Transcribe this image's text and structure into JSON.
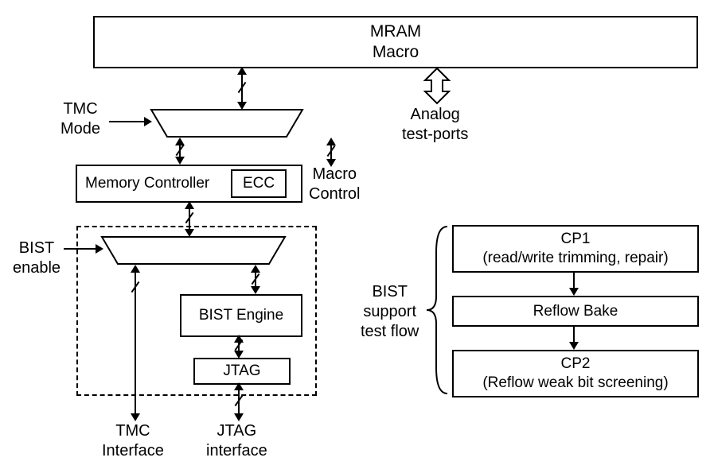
{
  "blocks": {
    "mram_macro_l1": "MRAM",
    "mram_macro_l2": "Macro",
    "mem_ctrl": "Memory Controller",
    "ecc": "ECC",
    "bist_engine": "BIST Engine",
    "jtag": "JTAG",
    "cp1_l1": "CP1",
    "cp1_l2": "(read/write trimming, repair)",
    "reflow_bake": "Reflow Bake",
    "cp2_l1": "CP2",
    "cp2_l2": "(Reflow weak bit screening)"
  },
  "labels": {
    "tmc_mode_l1": "TMC",
    "tmc_mode_l2": "Mode",
    "analog_l1": "Analog",
    "analog_l2": "test-ports",
    "macro_ctrl_l1": "Macro",
    "macro_ctrl_l2": "Control",
    "bist_enable_l1": "BIST",
    "bist_enable_l2": "enable",
    "bist_flow_l1": "BIST",
    "bist_flow_l2": "support",
    "bist_flow_l3": "test flow",
    "tmc_if_l1": "TMC",
    "tmc_if_l2": "Interface",
    "jtag_if_l1": "JTAG",
    "jtag_if_l2": "interface"
  }
}
